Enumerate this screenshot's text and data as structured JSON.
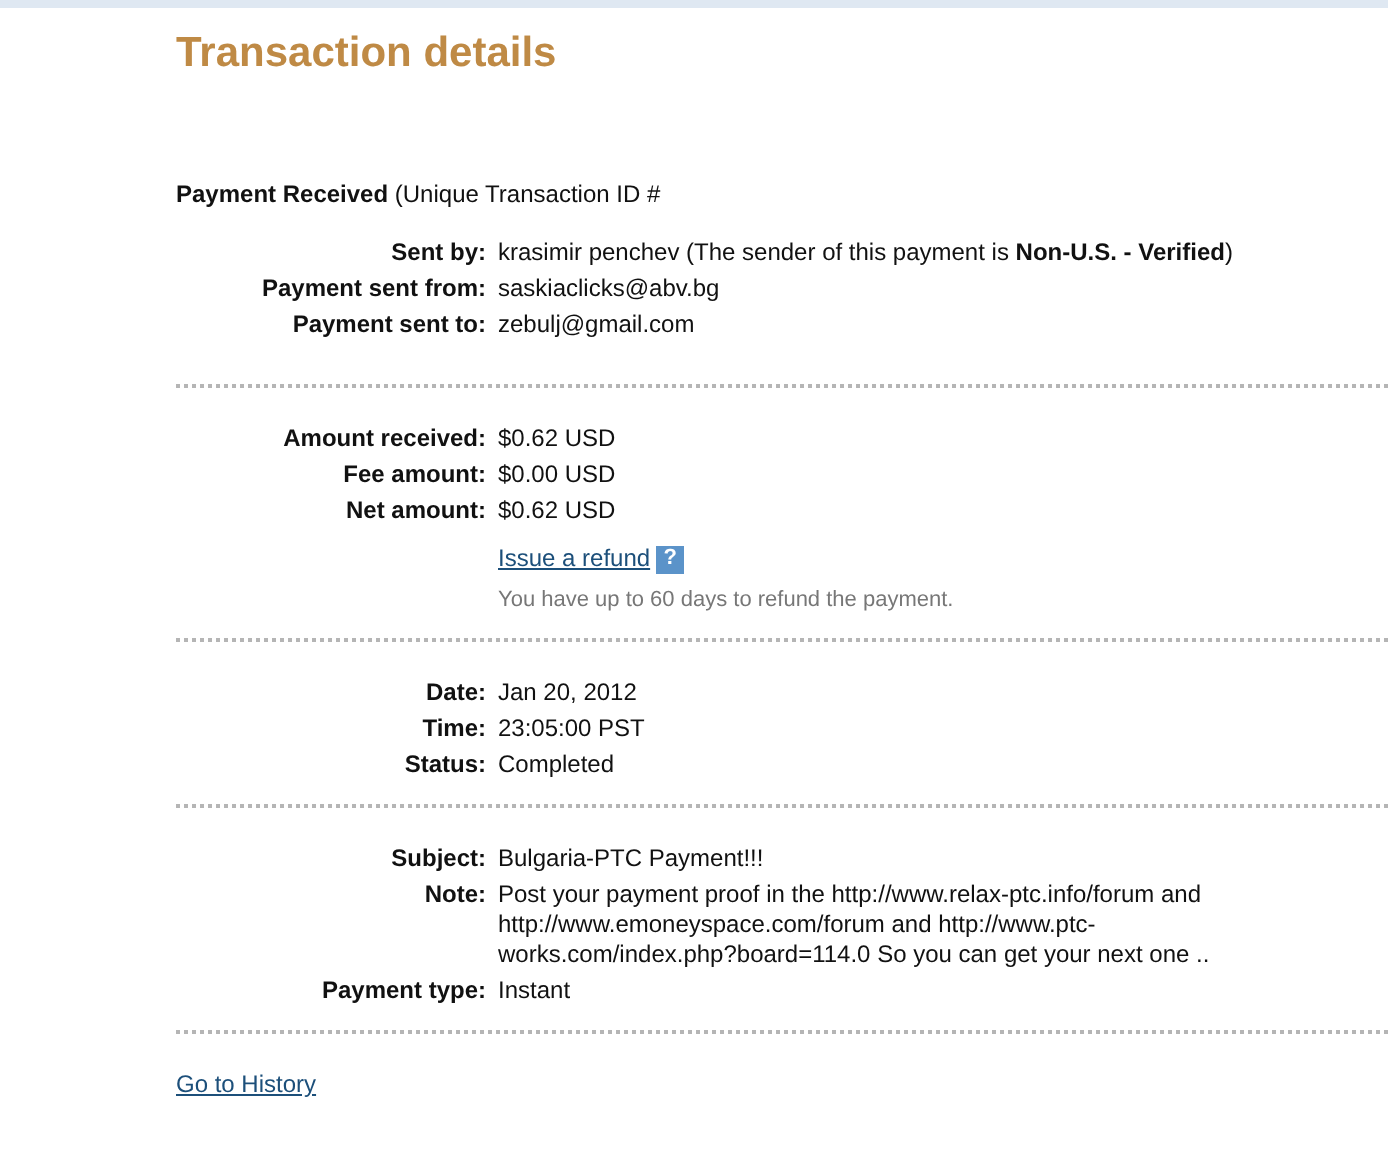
{
  "title": "Transaction details",
  "summary": "**Payment Received** (Unique Transaction ID #",
  "sections": [
    {
      "rows": [
        {
          "label": "Sent by:",
          "value": "krasimir penchev (The sender of this payment is **Non-U.S. - Verified**)"
        },
        {
          "label": "Payment sent from:",
          "value": "saskiaclicks@abv.bg"
        },
        {
          "label": "Payment sent to:",
          "value": "zebulj@gmail.com"
        }
      ]
    },
    {
      "rows": [
        {
          "label": "Amount received:",
          "value": "$0.62 USD"
        },
        {
          "label": "Fee amount:",
          "value": "$0.00 USD"
        },
        {
          "label": "Net amount:",
          "value": "$0.62 USD"
        }
      ],
      "refund": {
        "link": "Issue a refund",
        "help": "?",
        "note": "You have up to 60 days to refund the payment."
      }
    },
    {
      "rows": [
        {
          "label": "Date:",
          "value": "Jan 20, 2012"
        },
        {
          "label": "Time:",
          "value": "23:05:00 PST"
        },
        {
          "label": "Status:",
          "value": "Completed"
        }
      ]
    },
    {
      "rows": [
        {
          "label": "Subject:",
          "value": "Bulgaria-PTC Payment!!!"
        },
        {
          "label": "Note:",
          "value": "Post your payment proof in the http://www.relax-ptc.info/forum and http://www.emoneyspace.com/forum and http://www.ptc-works.com/index.php?board=114.0 So you can get your next one .."
        },
        {
          "label": "Payment type:",
          "value": "Instant"
        }
      ]
    }
  ],
  "history_link": "Go to History"
}
